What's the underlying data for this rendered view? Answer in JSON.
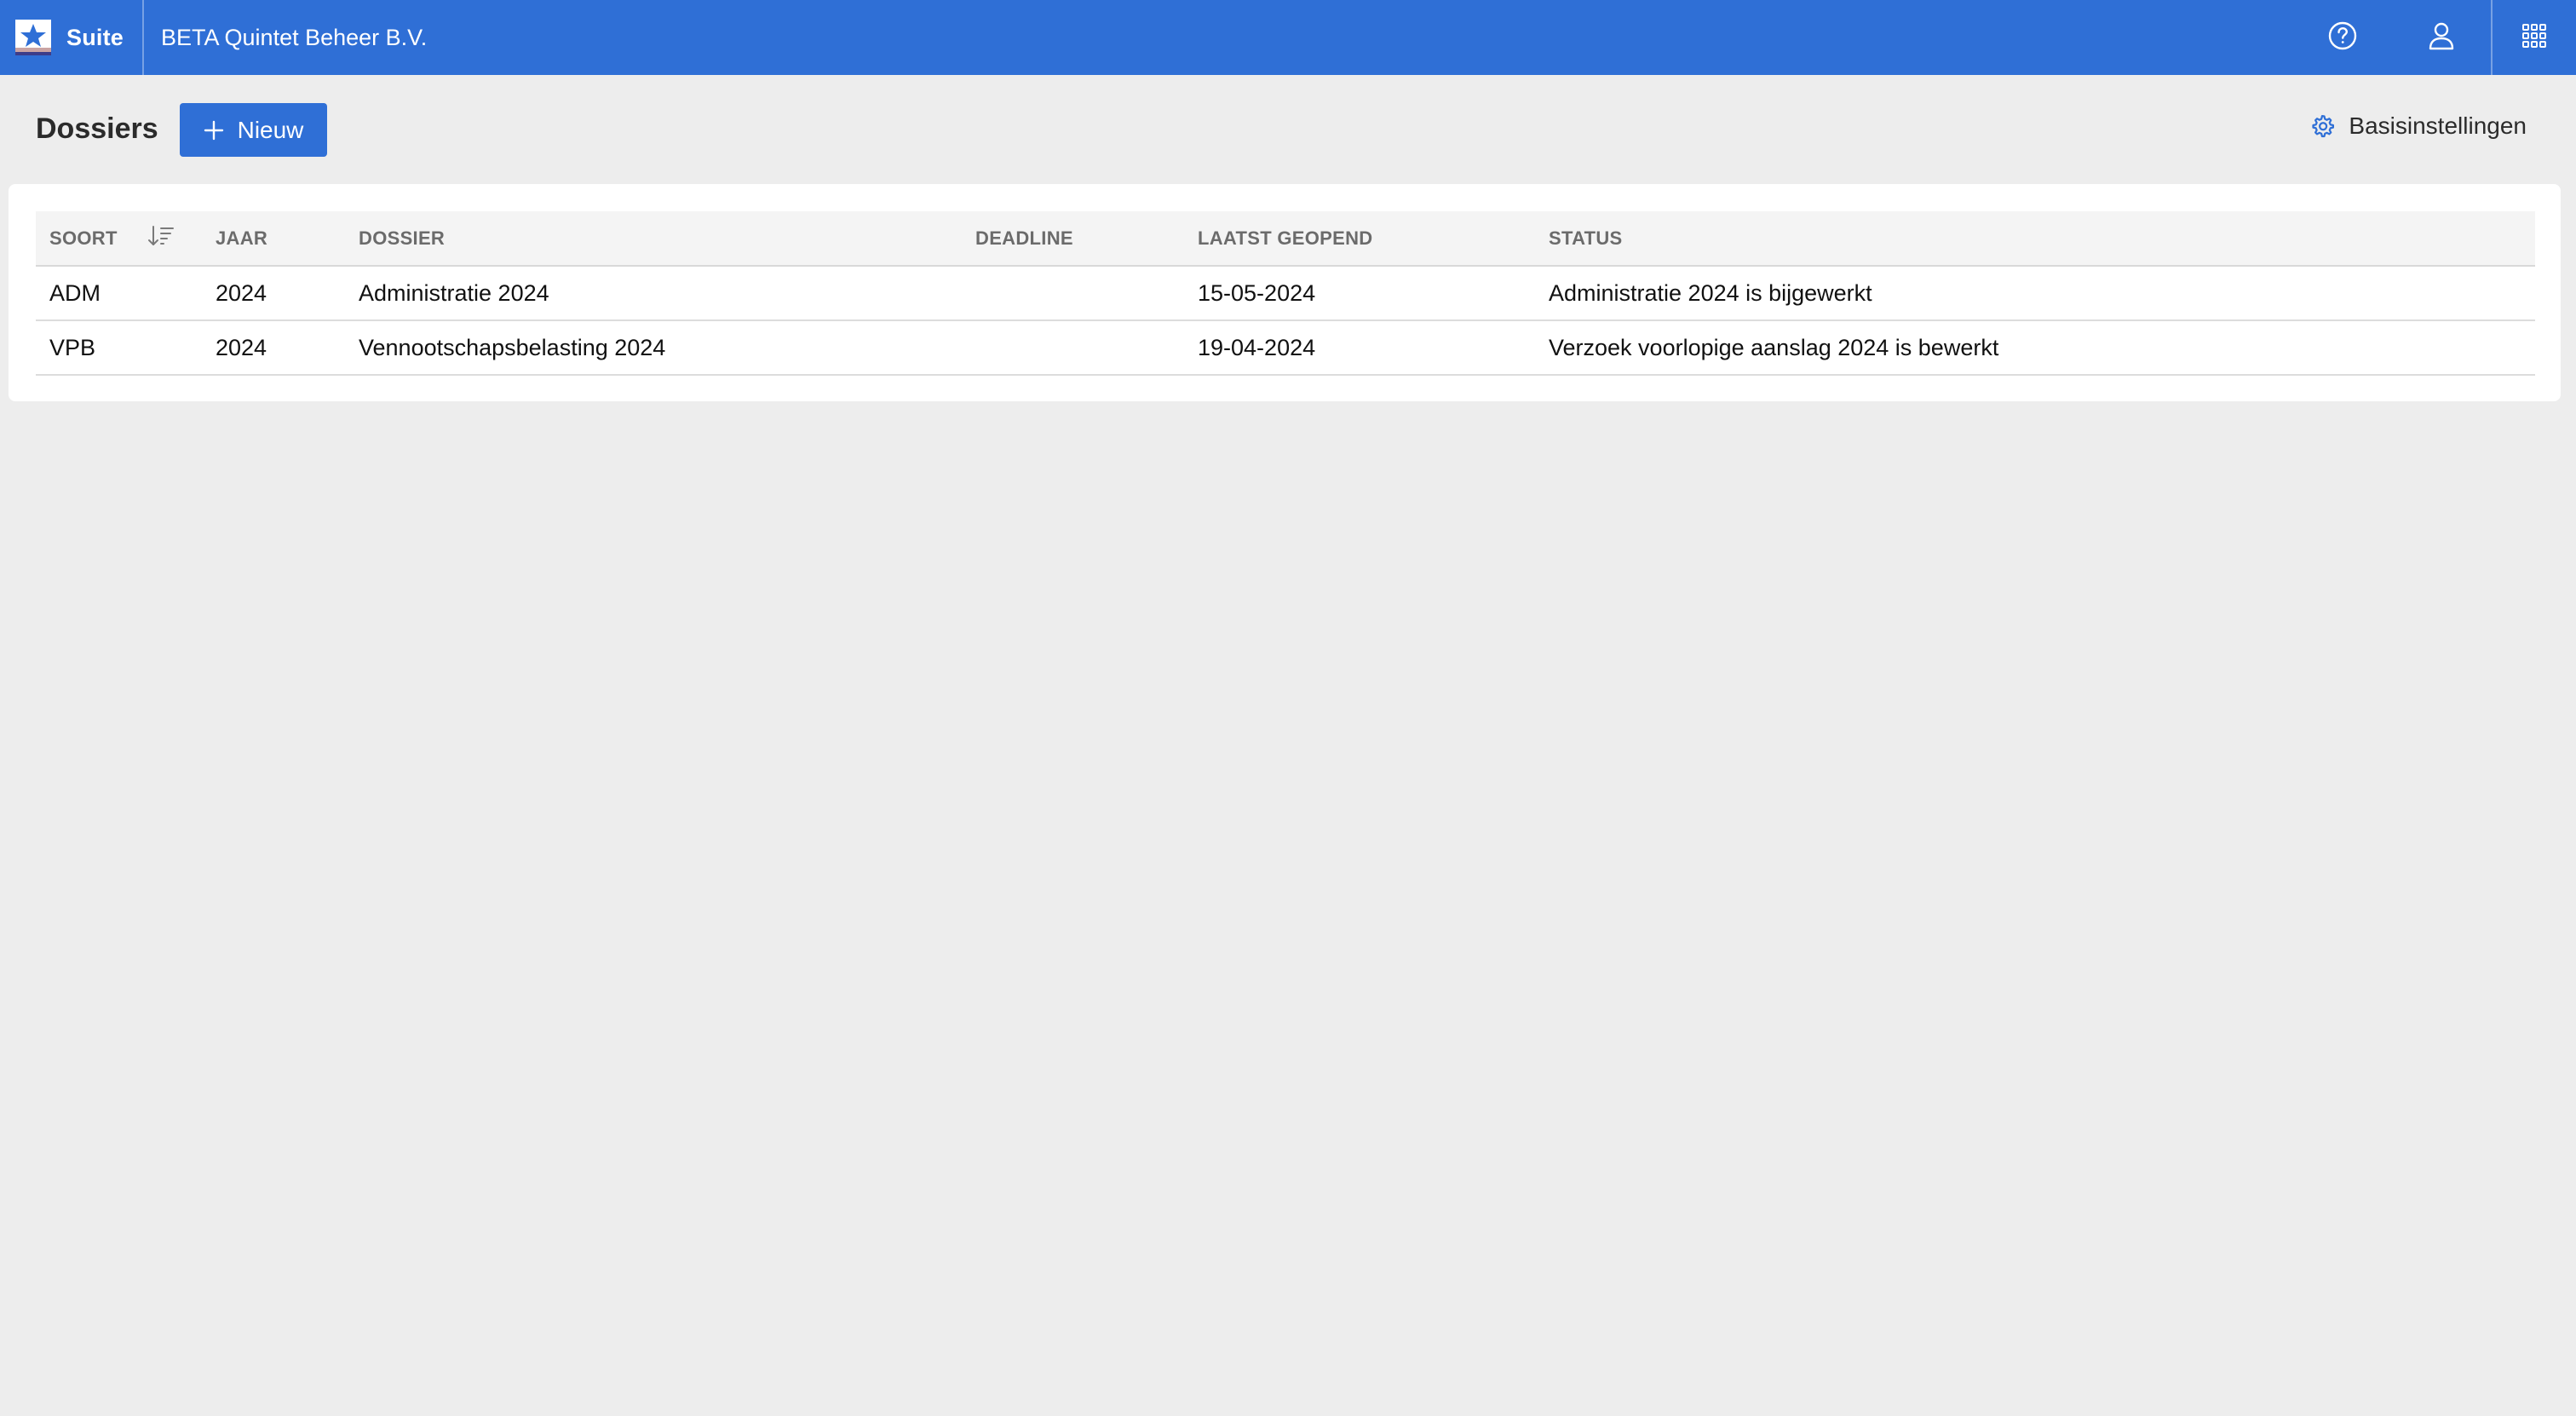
{
  "app": {
    "name": "Suite",
    "company": "BETA Quintet Beheer B.V.",
    "brand_color": "#2f6fd6",
    "icons": {
      "logo": "star-logo-icon",
      "help": "help-circle-icon",
      "user": "user-icon",
      "apps": "apps-grid-icon"
    }
  },
  "page": {
    "title": "Dossiers",
    "new_button_label": "Nieuw",
    "settings_label": "Basisinstellingen"
  },
  "table": {
    "columns": {
      "soort": "SOORT",
      "jaar": "JAAR",
      "dossier": "DOSSIER",
      "deadline": "DEADLINE",
      "laatst_geopend": "LAATST GEOPEND",
      "status": "STATUS"
    },
    "rows": [
      {
        "soort": "ADM",
        "jaar": "2024",
        "dossier": "Administratie 2024",
        "deadline": "",
        "laatst_geopend": "15-05-2024",
        "status": "Administratie 2024 is bijgewerkt"
      },
      {
        "soort": "VPB",
        "jaar": "2024",
        "dossier": "Vennootschapsbelasting 2024",
        "deadline": "",
        "laatst_geopend": "19-04-2024",
        "status": "Verzoek voorlopige aanslag 2024 is bewerkt"
      }
    ]
  }
}
